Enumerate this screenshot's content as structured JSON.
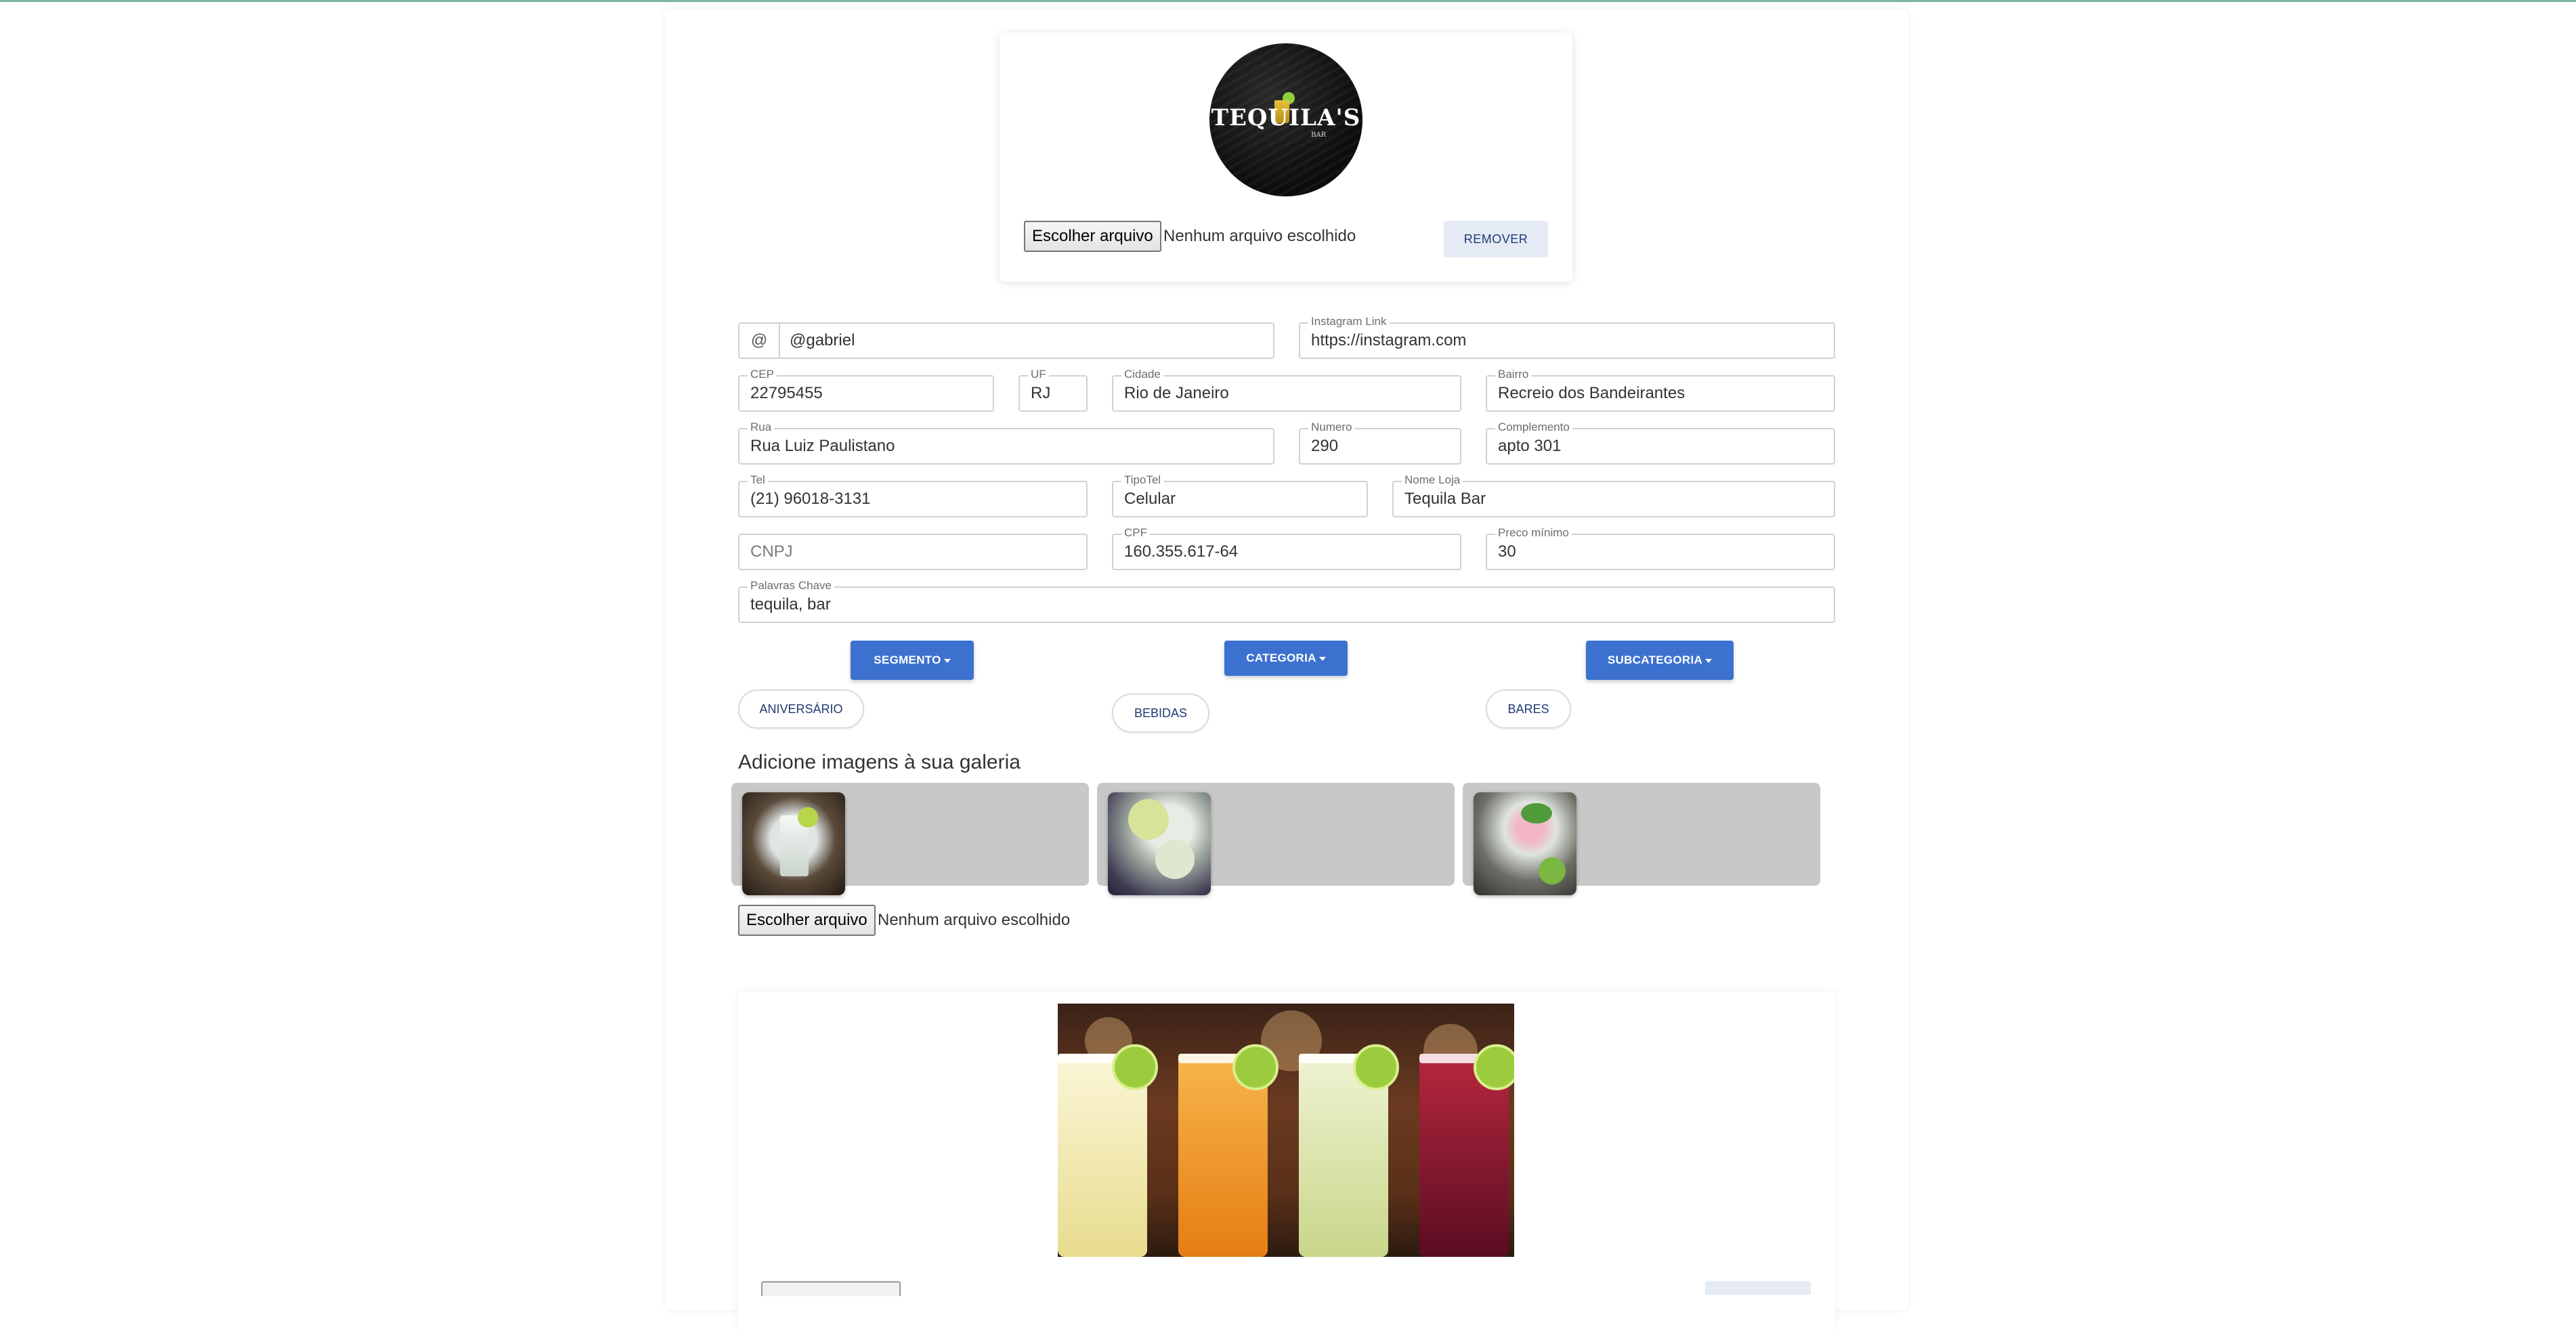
{
  "logo": {
    "text": "TEQUILA'S",
    "sub": "BAR"
  },
  "logo_upload": {
    "button": "Escolher arquivo",
    "status": "Nenhum arquivo escolhido",
    "remove": "REMOVER"
  },
  "form": {
    "instagram_user": {
      "prefix": "@",
      "value": "@gabriel"
    },
    "instagram_link": {
      "label": "Instagram Link",
      "value": "https://instagram.com"
    },
    "cep": {
      "label": "CEP",
      "value": "22795455"
    },
    "uf": {
      "label": "UF",
      "value": "RJ"
    },
    "cidade": {
      "label": "Cidade",
      "value": "Rio de Janeiro"
    },
    "bairro": {
      "label": "Bairro",
      "value": "Recreio dos Bandeirantes"
    },
    "rua": {
      "label": "Rua",
      "value": "Rua Luiz Paulistano"
    },
    "numero": {
      "label": "Numero",
      "value": "290"
    },
    "complemento": {
      "label": "Complemento",
      "value": "apto 301"
    },
    "tel": {
      "label": "Tel",
      "value": "(21) 96018-3131"
    },
    "tipotel": {
      "label": "TipoTel",
      "value": "Celular"
    },
    "nome_loja": {
      "label": "Nome Loja",
      "value": "Tequila Bar"
    },
    "cnpj": {
      "placeholder": "CNPJ"
    },
    "cpf": {
      "label": "CPF",
      "value": "160.355.617-64"
    },
    "preco_minimo": {
      "label": "Preco mínimo",
      "value": "30"
    },
    "palavras_chave": {
      "label": "Palavras Chave",
      "value": "tequila, bar"
    }
  },
  "dropdowns": {
    "segmento": "SEGMENTO",
    "categoria": "CATEGORIA",
    "subcategoria": "SUBCATEGORIA"
  },
  "chips": {
    "segmento": "ANIVERSÁRIO",
    "categoria": "BEBIDAS",
    "subcategoria": "BARES"
  },
  "gallery": {
    "title": "Adicione imagens à sua galeria",
    "upload_button": "Escolher arquivo",
    "upload_status": "Nenhum arquivo escolhido"
  },
  "colors": {
    "primary": "#3d71cf",
    "chip_text": "#1f3b73",
    "gallery_bg": "#c8c8c8"
  }
}
